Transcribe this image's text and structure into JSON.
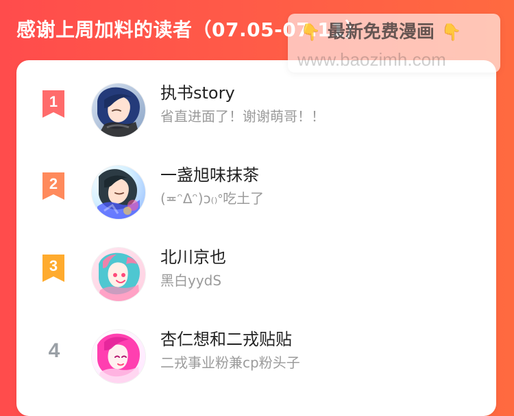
{
  "header": {
    "title": "感谢上周加料的读者（07.05-07.11）"
  },
  "watermark": {
    "emoji_left": "👇",
    "text_cn": "最新免费漫画",
    "emoji_right": "👇",
    "domain": "www.baozimh.com"
  },
  "colors": {
    "background_gradient_left": "#ff4c4c",
    "background_gradient_right": "#ff6a40",
    "card_background": "#ffffff",
    "rank_1": "#ff6b6b",
    "rank_2": "#ff8a5c",
    "rank_3": "#ffab2e",
    "rank_4_text": "#9aa0a6",
    "name_text": "#222222",
    "subtitle_text": "#9b9b9b"
  },
  "readers": [
    {
      "rank": "1",
      "name": "执书story",
      "message": "省直进面了！谢谢萌哥！！",
      "avatar_icon": "avatar-anime-blue-hair"
    },
    {
      "rank": "2",
      "name": "一盏旭味抹茶",
      "message": "(≖ᵔᐃᵔ)ↄ₍₎ᐤ吃土了",
      "avatar_icon": "avatar-anime-boy-colorful"
    },
    {
      "rank": "3",
      "name": "北川京也",
      "message": "黑白yydS",
      "avatar_icon": "avatar-anime-teal-hair"
    },
    {
      "rank": "4",
      "name": "杏仁想和二戎贴贴",
      "message": "二戎事业粉兼cp粉头子",
      "avatar_icon": "avatar-anime-pink-hair"
    }
  ]
}
